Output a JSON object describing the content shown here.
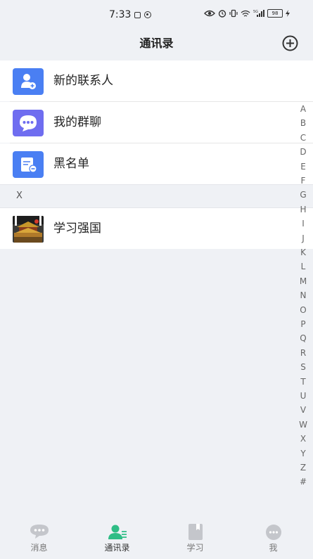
{
  "status_bar": {
    "time": "7:33",
    "battery": "98",
    "network": "5G"
  },
  "header": {
    "title": "通讯录"
  },
  "entries": [
    {
      "label": "新的联系人",
      "icon": "add-contact-icon",
      "color": "#4a7ff3"
    },
    {
      "label": "我的群聊",
      "icon": "group-chat-icon",
      "color": "#6f6df0"
    },
    {
      "label": "黑名单",
      "icon": "blacklist-icon",
      "color": "#4a7ff3"
    }
  ],
  "sections": [
    {
      "letter": "X",
      "contacts": [
        {
          "name": "学习强国",
          "avatar": "palace-photo"
        }
      ]
    }
  ],
  "index_letters": [
    "A",
    "B",
    "C",
    "D",
    "E",
    "F",
    "G",
    "H",
    "I",
    "J",
    "K",
    "L",
    "M",
    "N",
    "O",
    "P",
    "Q",
    "R",
    "S",
    "T",
    "U",
    "V",
    "W",
    "X",
    "Y",
    "Z",
    "#"
  ],
  "tabs": [
    {
      "label": "消息",
      "icon": "chat-bubble-icon",
      "active": false
    },
    {
      "label": "通讯录",
      "icon": "contacts-icon",
      "active": true
    },
    {
      "label": "学习",
      "icon": "book-icon",
      "active": false
    },
    {
      "label": "我",
      "icon": "profile-icon",
      "active": false
    }
  ],
  "colors": {
    "accent_green": "#2fbd86",
    "tab_inactive": "#c4c6cb",
    "background": "#eff1f5"
  }
}
